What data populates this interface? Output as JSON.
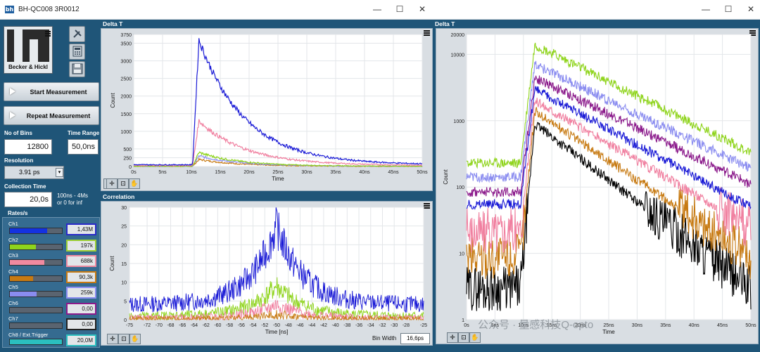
{
  "left_window": {
    "title": "BH-QC008 3R0012",
    "app_icon": "bh-app-icon",
    "controls": {
      "minimize": "—",
      "maximize": "☐",
      "close": "✕"
    },
    "logo_text": "Becker & Hickl",
    "logo_mark": "bh",
    "tools": [
      "wrench-screwdriver-icon",
      "calculator-icon",
      "save-disk-icon"
    ],
    "start_button": "Start Measurement",
    "repeat_button": "Repeat Measurement",
    "no_of_bins_label": "No of Bins",
    "no_of_bins_value": "12800",
    "time_range_label": "Time Range",
    "time_range_value": "50,0ns",
    "resolution_label": "Resolution",
    "resolution_value": "3.91 ps",
    "collection_time_label": "Collection Time",
    "collection_time_value": "20,0s",
    "collection_hint": "100ns - 4Ms\nor 0 for inf",
    "rates_label": "Rates/s",
    "channels": [
      {
        "name": "Ch1",
        "value": "1,43M",
        "color": "#1432e0",
        "border": "#2a2ac8",
        "fill": 0.72
      },
      {
        "name": "Ch2",
        "value": "197k",
        "color": "#8fd41c",
        "border": "#9acd32",
        "fill": 0.5
      },
      {
        "name": "Ch3",
        "value": "688k",
        "color": "#f08aa0",
        "border": "#f08aa0",
        "fill": 0.66
      },
      {
        "name": "Ch4",
        "value": "90,3k",
        "color": "#c77a12",
        "border": "#c77a12",
        "fill": 0.44
      },
      {
        "name": "Ch5",
        "value": "259k",
        "color": "#8a8cf0",
        "border": "#8a8cf0",
        "fill": 0.52
      },
      {
        "name": "Ch6",
        "value": "0,00",
        "color": "#8b1a8b",
        "border": "#8b1a8b",
        "fill": 0
      },
      {
        "name": "Ch7",
        "value": "0,00",
        "color": "#222222",
        "border": "#222222",
        "fill": 0
      },
      {
        "name": "Ch8 / Ext.Trigger",
        "value": "20,0M",
        "color": "#2bbfbf",
        "border": "#2bbfbf",
        "fill": 1.0
      }
    ],
    "delta_t_panel_title": "Delta T",
    "correlation_panel_title": "Correlation",
    "bin_width_label": "Bin Width",
    "bin_width_value": "16,6ps"
  },
  "right_window": {
    "panel_title": "Delta T",
    "controls": {
      "minimize": "—",
      "maximize": "☐",
      "close": "✕"
    },
    "watermark": "公众号 · 量感科技Q-opto"
  },
  "chart_data": [
    {
      "type": "line",
      "xlabel": "Time",
      "ylabel": "Count",
      "x_ticks": [
        "0s",
        "5ns",
        "10ns",
        "15ns",
        "20ns",
        "25ns",
        "30ns",
        "35ns",
        "40ns",
        "45ns",
        "50ns"
      ],
      "y_ticks": [
        "0",
        "250",
        "500",
        "1000",
        "1500",
        "2000",
        "2500",
        "3000",
        "3500",
        "3750"
      ],
      "xlim": [
        0,
        50
      ],
      "ylim": [
        0,
        3750
      ],
      "grid": true,
      "series": [
        {
          "color": "#1a1ad6",
          "peak": 3600,
          "baseline": 50,
          "decay": 8
        },
        {
          "color": "#f080a0",
          "peak": 1300,
          "baseline": 30,
          "decay": 8
        },
        {
          "color": "#8fd41c",
          "peak": 400,
          "baseline": 10,
          "decay": 7
        },
        {
          "color": "#8a8cf0",
          "peak": 300,
          "baseline": 8,
          "decay": 7
        },
        {
          "color": "#c77a12",
          "peak": 200,
          "baseline": 5,
          "decay": 7
        }
      ]
    },
    {
      "type": "line",
      "xlabel": "Time [ns]",
      "ylabel": "Count",
      "x_ticks": [
        "-75",
        "-72",
        "-70",
        "-68",
        "-66",
        "-64",
        "-62",
        "-60",
        "-58",
        "-56",
        "-54",
        "-52",
        "-50",
        "-48",
        "-46",
        "-44",
        "-42",
        "-40",
        "-38",
        "-36",
        "-34",
        "-32",
        "-30",
        "-28",
        "-25"
      ],
      "y_ticks": [
        "0",
        "5",
        "10",
        "15",
        "20",
        "25",
        "30"
      ],
      "xlim": [
        -75,
        -25
      ],
      "ylim": [
        0,
        30
      ],
      "grid": true,
      "series": [
        {
          "color": "#1a1ad6",
          "peak": 25,
          "baseline": 4
        },
        {
          "color": "#8fd41c",
          "peak": 9,
          "baseline": 1
        },
        {
          "color": "#f080a0",
          "peak": 4,
          "baseline": 0.5
        },
        {
          "color": "#c77a12",
          "peak": 1.5,
          "baseline": 0.2
        }
      ]
    },
    {
      "type": "line",
      "xlabel": "Time",
      "ylabel": "Count",
      "scale_y": "log",
      "x_ticks": [
        "0s",
        "5ns",
        "10ns",
        "15ns",
        "20ns",
        "25ns",
        "30ns",
        "35ns",
        "40ns",
        "45ns",
        "50ns"
      ],
      "y_ticks": [
        "1",
        "10",
        "100",
        "1000",
        "10000",
        "20000"
      ],
      "xlim": [
        0,
        50
      ],
      "ylim": [
        1,
        20000
      ],
      "grid": true,
      "series": [
        {
          "color": "#8fd41c",
          "peak": 14000,
          "baseline": 230,
          "tail": 330
        },
        {
          "color": "#8a8cf0",
          "peak": 7000,
          "baseline": 140,
          "tail": 190
        },
        {
          "color": "#8b1a8b",
          "peak": 4500,
          "baseline": 85,
          "tail": 110
        },
        {
          "color": "#1a1ad6",
          "peak": 3000,
          "baseline": 55,
          "tail": 50
        },
        {
          "color": "#f080a0",
          "peak": 2000,
          "baseline": 22,
          "tail": 25
        },
        {
          "color": "#c77a12",
          "peak": 1400,
          "baseline": 9,
          "tail": 9
        },
        {
          "color": "#000000",
          "peak": 900,
          "baseline": 3,
          "tail": 3
        }
      ]
    }
  ]
}
